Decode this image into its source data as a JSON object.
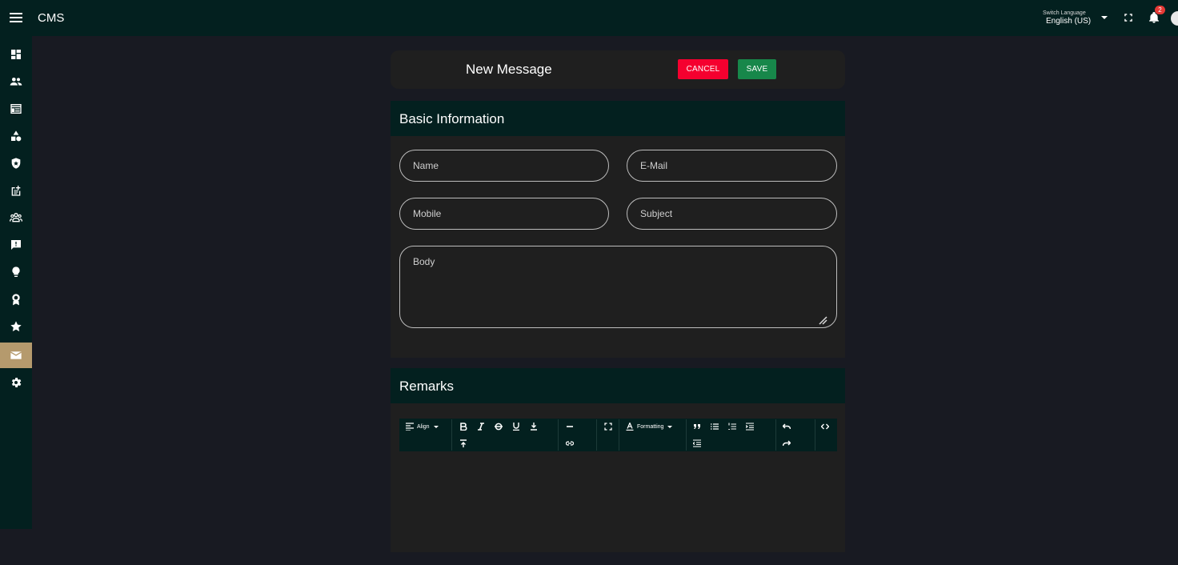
{
  "app": {
    "title": "CMS"
  },
  "topbar": {
    "language_caption": "Switch Language",
    "language_value": "English (US)",
    "notification_count": "2"
  },
  "sidebar": {
    "items": [
      {
        "icon": "dashboard-icon"
      },
      {
        "icon": "users-icon"
      },
      {
        "icon": "web-layout-icon"
      },
      {
        "icon": "category-icon"
      },
      {
        "icon": "shield-icon"
      },
      {
        "icon": "post-add-icon"
      },
      {
        "icon": "groups-icon"
      },
      {
        "icon": "feedback-icon"
      },
      {
        "icon": "lightbulb-icon"
      },
      {
        "icon": "award-icon"
      },
      {
        "icon": "star-icon"
      },
      {
        "icon": "mail-icon",
        "active": true
      },
      {
        "icon": "gear-icon"
      }
    ],
    "active_color": "#b59a6d"
  },
  "page": {
    "title": "New Message",
    "cancel_label": "CANCEL",
    "save_label": "SAVE"
  },
  "basic": {
    "heading": "Basic Information",
    "name_placeholder": "Name",
    "email_placeholder": "E-Mail",
    "mobile_placeholder": "Mobile",
    "subject_placeholder": "Subject",
    "body_placeholder": "Body"
  },
  "remarks": {
    "heading": "Remarks",
    "toolbar": {
      "align_label": "Align",
      "formatting_label": "Formatting"
    }
  },
  "colors": {
    "topbar": "#03201f",
    "background": "#181a22",
    "card": "#1f1f1f",
    "cancel": "#f5002f",
    "save": "#17874a"
  }
}
